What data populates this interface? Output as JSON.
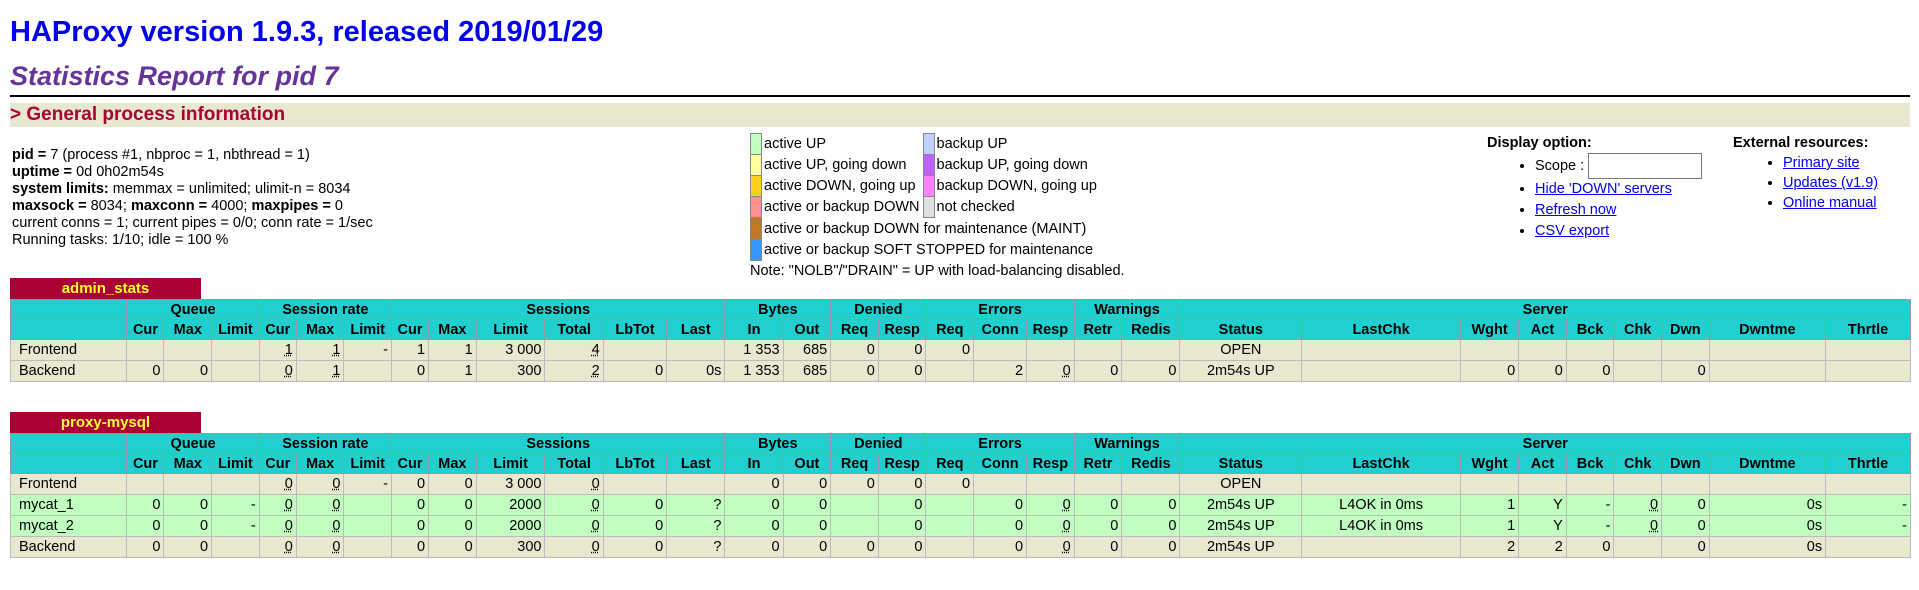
{
  "header": {
    "title": "HAProxy version 1.9.3, released 2019/01/29",
    "subtitle": "Statistics Report for pid 7"
  },
  "section": {
    "label": "> General process information"
  },
  "process_info": {
    "pid_label": "pid = ",
    "pid_value": "7 (process #1, nbproc = 1, nbthread = 1)",
    "uptime_label": "uptime = ",
    "uptime_value": "0d 0h02m54s",
    "syslimits_label": "system limits:",
    "syslimits_value": " memmax = unlimited; ulimit-n = 8034",
    "maxsock_label": "maxsock = ",
    "maxsock_value": "8034; ",
    "maxconn_label": "maxconn = ",
    "maxconn_value": "4000; ",
    "maxpipes_label": "maxpipes = ",
    "maxpipes_value": "0",
    "conns_line": "current conns = 1; current pipes = 0/0; conn rate = 1/sec",
    "tasks_line": "Running tasks: 1/10; idle = 100 %"
  },
  "legend": {
    "items_left": [
      {
        "label": "active UP",
        "color": "#c0ffc0"
      },
      {
        "label": "active UP, going down",
        "color": "#ffffa0"
      },
      {
        "label": "active DOWN, going up",
        "color": "#ffd020"
      },
      {
        "label": "active or backup DOWN",
        "color": "#ff9090"
      },
      {
        "label": "active or backup DOWN for maintenance (MAINT)",
        "color": "#c07820"
      },
      {
        "label": "active or backup SOFT STOPPED for maintenance",
        "color": "#3399ff"
      }
    ],
    "items_right": [
      {
        "label": "backup UP",
        "color": "#c0d0ff"
      },
      {
        "label": "backup UP, going down",
        "color": "#c060ff"
      },
      {
        "label": "backup DOWN, going up",
        "color": "#ff80ff"
      },
      {
        "label": "not checked",
        "color": "#e0e0e0"
      }
    ],
    "note": "Note: \"NOLB\"/\"DRAIN\" = UP with load-balancing disabled."
  },
  "display_options": {
    "title": "Display option:",
    "scope_label": "Scope :",
    "scope_value": "",
    "links": [
      "Hide 'DOWN' servers",
      "Refresh now",
      "CSV export"
    ]
  },
  "external_resources": {
    "title": "External resources:",
    "links": [
      "Primary site",
      "Updates (v1.9)",
      "Online manual"
    ]
  },
  "headers": {
    "groups_a": [
      "Queue",
      "Session rate",
      "Sessions",
      "Bytes",
      "Denied",
      "Errors",
      "Warnings",
      "Server"
    ],
    "cols": [
      "Cur",
      "Max",
      "Limit",
      "Cur",
      "Max",
      "Limit",
      "Cur",
      "Max",
      "Limit",
      "Total",
      "LbTot",
      "Last",
      "In",
      "Out",
      "Req",
      "Resp",
      "Req",
      "Conn",
      "Resp",
      "Retr",
      "Redis",
      "Status",
      "LastChk",
      "Wght",
      "Act",
      "Bck",
      "Chk",
      "Dwn",
      "Dwntme",
      "Thrtle"
    ]
  },
  "proxies": [
    {
      "name": "admin_stats",
      "rows": [
        {
          "type": "fe",
          "name": "Frontend",
          "cells": [
            "",
            "",
            "",
            "1",
            "1",
            "-",
            "1",
            "1",
            "3 000",
            "4",
            "",
            "",
            "1 353",
            "685",
            "0",
            "0",
            "0",
            "",
            "",
            "",
            "",
            "OPEN",
            "",
            "",
            "",
            "",
            "",
            "",
            "",
            ""
          ]
        },
        {
          "type": "be",
          "name": "Backend",
          "cells": [
            "0",
            "0",
            "",
            "0",
            "1",
            "",
            "0",
            "1",
            "300",
            "2",
            "0",
            "0s",
            "1 353",
            "685",
            "0",
            "0",
            "",
            "2",
            "0",
            "0",
            "0",
            "2m54s UP",
            "",
            "0",
            "0",
            "0",
            "",
            "0",
            "",
            ""
          ]
        }
      ]
    },
    {
      "name": "proxy-mysql",
      "rows": [
        {
          "type": "fe",
          "name": "Frontend",
          "cells": [
            "",
            "",
            "",
            "0",
            "0",
            "-",
            "0",
            "0",
            "3 000",
            "0",
            "",
            "",
            "0",
            "0",
            "0",
            "0",
            "0",
            "",
            "",
            "",
            "",
            "OPEN",
            "",
            "",
            "",
            "",
            "",
            "",
            "",
            ""
          ]
        },
        {
          "type": "up",
          "name": "mycat_1",
          "cells": [
            "0",
            "0",
            "-",
            "0",
            "0",
            "",
            "0",
            "0",
            "2000",
            "0",
            "0",
            "?",
            "0",
            "0",
            "",
            "0",
            "",
            "0",
            "0",
            "0",
            "0",
            "2m54s UP",
            "L4OK in 0ms",
            "1",
            "Y",
            "-",
            "0",
            "0",
            "0s",
            "-"
          ]
        },
        {
          "type": "up",
          "name": "mycat_2",
          "cells": [
            "0",
            "0",
            "-",
            "0",
            "0",
            "",
            "0",
            "0",
            "2000",
            "0",
            "0",
            "?",
            "0",
            "0",
            "",
            "0",
            "",
            "0",
            "0",
            "0",
            "0",
            "2m54s UP",
            "L4OK in 0ms",
            "1",
            "Y",
            "-",
            "0",
            "0",
            "0s",
            "-"
          ]
        },
        {
          "type": "be",
          "name": "Backend",
          "cells": [
            "0",
            "0",
            "",
            "0",
            "0",
            "",
            "0",
            "0",
            "300",
            "0",
            "0",
            "?",
            "0",
            "0",
            "0",
            "0",
            "",
            "0",
            "0",
            "0",
            "0",
            "2m54s UP",
            "",
            "2",
            "2",
            "0",
            "",
            "0",
            "0s",
            ""
          ]
        }
      ]
    }
  ]
}
